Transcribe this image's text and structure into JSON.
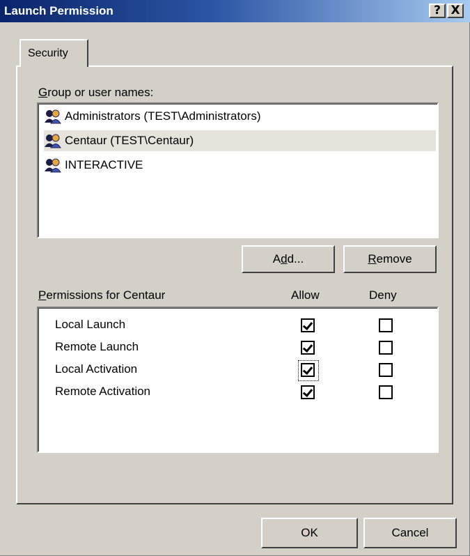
{
  "window": {
    "title": "Launch Permission",
    "help_button": "?",
    "close_button": "X"
  },
  "tabs": [
    {
      "label": "Security",
      "active": true
    }
  ],
  "groups": {
    "label_prefix": "G",
    "label_rest": "roup or user names:",
    "items": [
      {
        "label": "Administrators (TEST\\Administrators)",
        "icon": "users-icon",
        "selected": false
      },
      {
        "label": "Centaur (TEST\\Centaur)",
        "icon": "users-icon",
        "selected": true
      },
      {
        "label": "INTERACTIVE",
        "icon": "users-icon",
        "selected": false
      }
    ]
  },
  "buttons": {
    "add_pre": "A",
    "add_ul": "d",
    "add_post": "d...",
    "remove_ul": "R",
    "remove_post": "emove",
    "ok": "OK",
    "cancel": "Cancel"
  },
  "permissions": {
    "label_ul": "P",
    "label_rest": "ermissions for Centaur",
    "allow_header": "Allow",
    "deny_header": "Deny",
    "items": [
      {
        "name": "Local Launch",
        "allow": true,
        "deny": false
      },
      {
        "name": "Remote Launch",
        "allow": true,
        "deny": false
      },
      {
        "name": "Local Activation",
        "allow": true,
        "deny": false,
        "focused": true
      },
      {
        "name": "Remote Activation",
        "allow": true,
        "deny": false
      }
    ]
  }
}
